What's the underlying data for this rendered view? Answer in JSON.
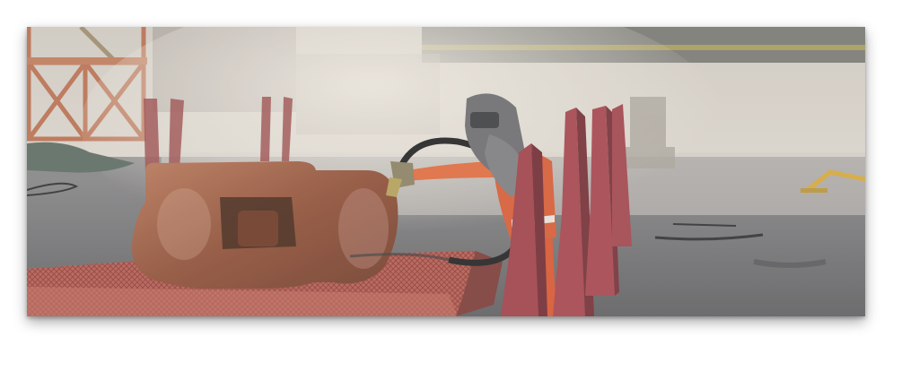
{
  "image": {
    "subject": "sandblasting-worker",
    "colors": {
      "haze": "#d8d4cc",
      "ground": "#6e6e70",
      "rust": "#9a5a3e",
      "steel_red": "#a0444c",
      "coverall": "#d9552e",
      "grating": "#b45a52"
    }
  }
}
